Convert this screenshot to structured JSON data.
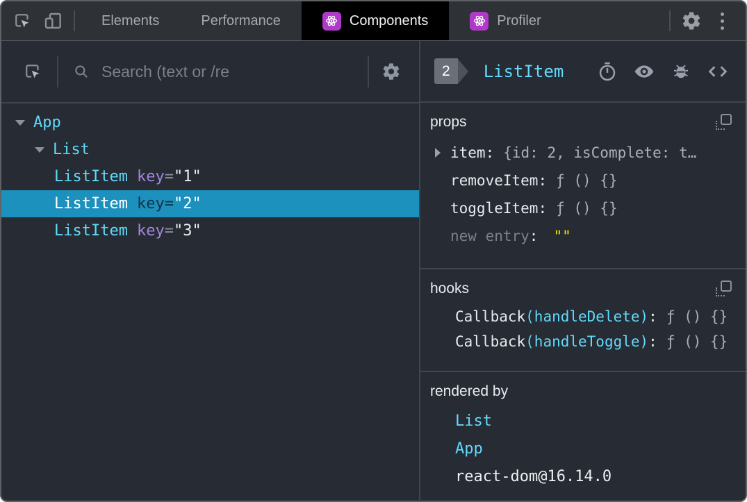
{
  "toolbar": {
    "tabs": [
      {
        "label": "Elements",
        "active": false,
        "icon": null
      },
      {
        "label": "Performance",
        "active": false,
        "icon": null
      },
      {
        "label": "Components",
        "active": true,
        "icon": "react-atom"
      },
      {
        "label": "Profiler",
        "active": false,
        "icon": "react-atom"
      }
    ],
    "icons": [
      "inspect-element",
      "toggle-device-toolbar",
      "settings-gear",
      "more-options-kebab"
    ]
  },
  "left_panel": {
    "search": {
      "placeholder": "Search (text or /re"
    },
    "icons": [
      "select-component",
      "search-magnifier",
      "settings-gear"
    ]
  },
  "tree": {
    "rows": [
      {
        "name": "App",
        "indent": 0,
        "expanded": true,
        "selected": false
      },
      {
        "name": "List",
        "indent": 1,
        "expanded": true,
        "selected": false
      },
      {
        "name": "ListItem",
        "attr": "key",
        "eq": "=",
        "value": "\"1\"",
        "indent": 2,
        "selected": false
      },
      {
        "name": "ListItem",
        "attr": "key",
        "eq": "=",
        "value": "\"2\"",
        "indent": 2,
        "selected": true
      },
      {
        "name": "ListItem",
        "attr": "key",
        "eq": "=",
        "value": "\"3\"",
        "indent": 2,
        "selected": false
      }
    ]
  },
  "punct": {
    "colon": ":"
  },
  "details": {
    "badge_count": "2",
    "component_name": "ListItem",
    "header_icons": [
      "suspend-stopwatch",
      "inspect-eye",
      "log-bug",
      "view-source-code"
    ],
    "props": {
      "title": "props",
      "rows": [
        {
          "name": "item",
          "value": "{id: 2, isComplete: t…",
          "expandable": true
        },
        {
          "name": "removeItem",
          "value": "ƒ () {}"
        },
        {
          "name": "toggleItem",
          "value": "ƒ () {}"
        },
        {
          "name": "new entry",
          "value": "\"\"",
          "editable": true
        }
      ]
    },
    "hooks": {
      "title": "hooks",
      "rows": [
        {
          "name": "Callback",
          "fn": "(handleDelete)",
          "value": "ƒ () {}"
        },
        {
          "name": "Callback",
          "fn": "(handleToggle)",
          "value": "ƒ () {}"
        }
      ]
    },
    "rendered_by": {
      "title": "rendered by",
      "items": [
        {
          "label": "List",
          "link": true
        },
        {
          "label": "App",
          "link": true
        },
        {
          "label": "react-dom@16.14.0",
          "link": false
        }
      ]
    }
  },
  "colors": {
    "component_name_cyan": "#61dafb",
    "attr_key_purple": "#a385e0",
    "selected_row_bg": "#1d91bd",
    "string_yellow": "#e8e600",
    "react_icon_purple": "#b039c9",
    "panel_bg": "#272b33",
    "toolbar_bg": "#2e3135"
  }
}
